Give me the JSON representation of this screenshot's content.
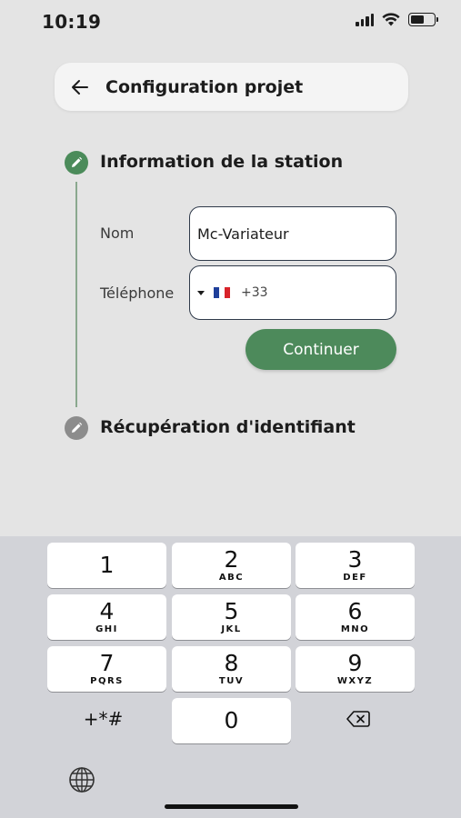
{
  "status_bar": {
    "time": "10:19",
    "battery_level": 0.6
  },
  "header": {
    "title": "Configuration projet",
    "back_icon": "arrow-left-icon"
  },
  "steps": [
    {
      "title": "Information de la station",
      "state": "active",
      "icon": "pencil-icon",
      "color": "#4b8b5a"
    },
    {
      "title": "Récupération d'identifiant",
      "state": "inactive",
      "icon": "pencil-icon",
      "color": "#8c8c8c"
    }
  ],
  "form": {
    "name_label": "Nom",
    "name_value": "Mc-Variateur",
    "phone_label": "Téléphone",
    "phone_country_icon": "france-flag-icon",
    "phone_dial_code": "+33",
    "continue_label": "Continuer"
  },
  "colors": {
    "accent": "#4d8a5b",
    "background": "#e4e4e4",
    "keyboard": "#d2d3d8"
  },
  "keyboard": {
    "keys": [
      {
        "num": "1",
        "letters": ""
      },
      {
        "num": "2",
        "letters": "ABC"
      },
      {
        "num": "3",
        "letters": "DEF"
      },
      {
        "num": "4",
        "letters": "GHI"
      },
      {
        "num": "5",
        "letters": "JKL"
      },
      {
        "num": "6",
        "letters": "MNO"
      },
      {
        "num": "7",
        "letters": "PQRS"
      },
      {
        "num": "8",
        "letters": "TUV"
      },
      {
        "num": "9",
        "letters": "WXYZ"
      },
      {
        "num": "0",
        "letters": ""
      }
    ],
    "symbols_label": "+*#",
    "delete_icon": "backspace-icon",
    "globe_icon": "globe-icon"
  }
}
